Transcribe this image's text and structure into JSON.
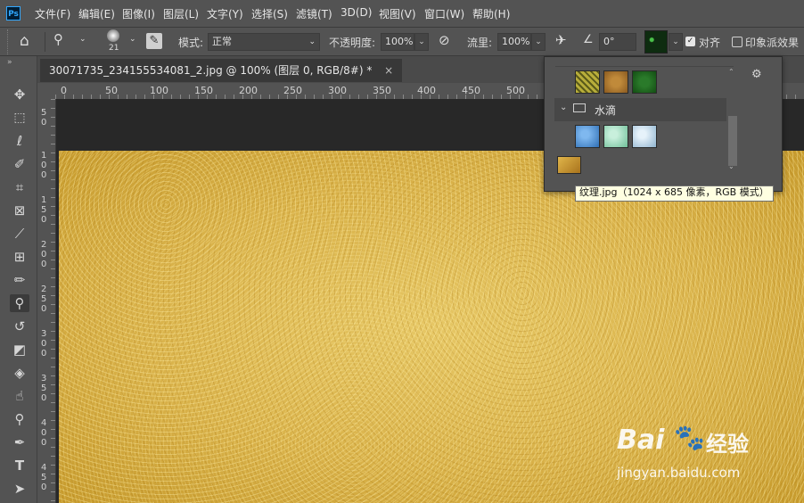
{
  "app": {
    "logo_text": "Ps"
  },
  "menu": [
    "文件(F)",
    "编辑(E)",
    "图像(I)",
    "图层(L)",
    "文字(Y)",
    "选择(S)",
    "滤镜(T)",
    "3D(D)",
    "视图(V)",
    "窗口(W)",
    "帮助(H)"
  ],
  "options": {
    "brush_size": "21",
    "mode_label": "模式:",
    "mode_value": "正常",
    "opacity_label": "不透明度:",
    "opacity_value": "100%",
    "flow_label": "流里:",
    "flow_value": "100%",
    "angle_value": "0°",
    "align_label": "对齐",
    "impressionist_label": "印象派效果",
    "align_checked": true,
    "impressionist_checked": false
  },
  "document": {
    "tab_title": "30071735_234155534081_2.jpg @ 100% (图层 0, RGB/8#) *"
  },
  "ruler_h": [
    "0",
    "50",
    "100",
    "150",
    "200",
    "250",
    "300",
    "350",
    "400",
    "450",
    "500"
  ],
  "ruler_v": [
    "5 0",
    "1 0 0",
    "1 5 0",
    "2 0 0",
    "2 5 0",
    "3 0 0",
    "3 5 0",
    "4 0 0",
    "4 5 0"
  ],
  "pattern_picker": {
    "group_name": "水滴",
    "swatches_row1": [
      "#b7ad3a",
      "#a9782f",
      "#2a6a2a"
    ],
    "swatches_row2": [
      "#3f87cf",
      "#8fd3b0",
      "#b4d4e8"
    ],
    "swatch_row3": [
      "#c9902b"
    ],
    "tooltip": "纹理.jpg（1024 x 685 像素，RGB 模式）"
  },
  "watermark": {
    "brand": "Bai",
    "brand_cn": "经验",
    "url": "jingyan.baidu.com"
  },
  "colors": {
    "accent": "#31a8ff",
    "panel": "#535353",
    "canvas_bg": "#282828"
  }
}
